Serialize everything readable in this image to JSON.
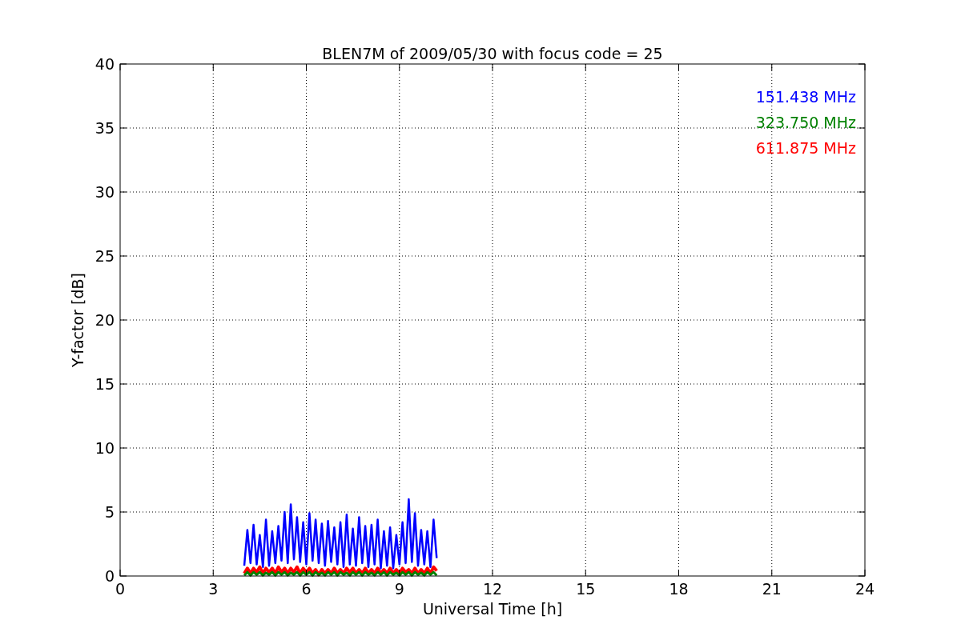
{
  "plot": {
    "chart_data": {
      "type": "line",
      "title": "BLEN7M of 2009/05/30 with focus code = 25",
      "xlabel": "Universal Time [h]",
      "ylabel": "Y-factor [dB]",
      "x": [
        4.0,
        4.1,
        4.2,
        4.3,
        4.4,
        4.5,
        4.6,
        4.7,
        4.8,
        4.9,
        5.0,
        5.1,
        5.2,
        5.3,
        5.4,
        5.5,
        5.6,
        5.7,
        5.8,
        5.9,
        6.0,
        6.1,
        6.2,
        6.3,
        6.4,
        6.5,
        6.6,
        6.7,
        6.8,
        6.9,
        7.0,
        7.1,
        7.2,
        7.3,
        7.4,
        7.5,
        7.6,
        7.7,
        7.8,
        7.9,
        8.0,
        8.1,
        8.2,
        8.3,
        8.4,
        8.5,
        8.6,
        8.7,
        8.8,
        8.9,
        9.0,
        9.1,
        9.2,
        9.3,
        9.4,
        9.5,
        9.6,
        9.7,
        9.8,
        9.9,
        10.0,
        10.1,
        10.2
      ],
      "series": [
        {
          "name": "151.438 MHz",
          "color": "#0000ff",
          "values": [
            0.8,
            3.6,
            1.0,
            4.0,
            0.9,
            3.2,
            0.7,
            4.4,
            0.8,
            3.5,
            1.0,
            3.9,
            1.2,
            5.0,
            1.0,
            5.6,
            1.3,
            4.6,
            1.1,
            4.2,
            0.9,
            4.9,
            1.2,
            4.4,
            1.0,
            4.1,
            0.8,
            4.3,
            1.1,
            3.8,
            0.9,
            4.2,
            0.7,
            4.8,
            0.9,
            3.7,
            0.8,
            4.6,
            1.0,
            3.9,
            0.7,
            4.0,
            0.9,
            4.4,
            0.6,
            3.5,
            0.8,
            3.8,
            0.6,
            3.2,
            0.9,
            4.2,
            1.0,
            6.0,
            1.1,
            4.9,
            0.8,
            3.6,
            0.9,
            3.5,
            0.7,
            4.4,
            1.4
          ]
        },
        {
          "name": "323.750 MHz",
          "color": "#008000",
          "values": [
            0.05,
            0.3,
            0.05,
            0.3,
            0.1,
            0.3,
            0.05,
            0.25,
            0.1,
            0.3,
            0.05,
            0.3,
            0.1,
            0.3,
            0.05,
            0.25,
            0.1,
            0.3,
            0.05,
            0.3,
            0.1,
            0.3,
            0.05,
            0.3,
            0.1,
            0.25,
            0.05,
            0.3,
            0.1,
            0.3,
            0.05,
            0.3,
            0.1,
            0.25,
            0.05,
            0.3,
            0.1,
            0.3,
            0.05,
            0.3,
            0.1,
            0.25,
            0.05,
            0.3,
            0.1,
            0.3,
            0.05,
            0.3,
            0.1,
            0.25,
            0.05,
            0.3,
            0.1,
            0.3,
            0.05,
            0.3,
            0.1,
            0.25,
            0.05,
            0.3,
            0.1,
            0.3,
            0.05
          ]
        },
        {
          "name": "611.875 MHz",
          "color": "#ff0000",
          "values": [
            0.2,
            0.6,
            0.2,
            0.6,
            0.3,
            0.7,
            0.2,
            0.6,
            0.3,
            0.6,
            0.2,
            0.7,
            0.3,
            0.6,
            0.2,
            0.6,
            0.3,
            0.7,
            0.2,
            0.6,
            0.3,
            0.6,
            0.2,
            0.5,
            0.1,
            0.5,
            0.2,
            0.5,
            0.2,
            0.6,
            0.2,
            0.5,
            0.2,
            0.6,
            0.3,
            0.6,
            0.2,
            0.5,
            0.2,
            0.6,
            0.2,
            0.5,
            0.2,
            0.6,
            0.2,
            0.5,
            0.2,
            0.6,
            0.2,
            0.5,
            0.2,
            0.6,
            0.3,
            0.5,
            0.2,
            0.6,
            0.2,
            0.5,
            0.2,
            0.6,
            0.2,
            0.7,
            0.4
          ]
        }
      ],
      "grid": true,
      "xlim": [
        0,
        24
      ],
      "ylim": [
        0,
        40
      ],
      "xticks": [
        0,
        3,
        6,
        9,
        12,
        15,
        18,
        21,
        24
      ],
      "yticks": [
        0,
        5,
        10,
        15,
        20,
        25,
        30,
        35,
        40
      ]
    }
  }
}
